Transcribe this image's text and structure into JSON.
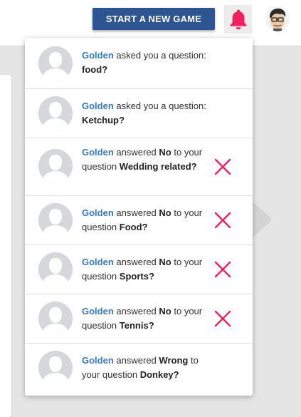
{
  "header": {
    "start_button": "START A NEW GAME",
    "bell_color": "#f1215f",
    "button_color": "#2c5591"
  },
  "notifications": [
    {
      "name": "Golden",
      "verb": "asked you a question:",
      "answer": "",
      "mid": "",
      "subject": "food?",
      "dismissible": false
    },
    {
      "name": "Golden",
      "verb": "asked you a question:",
      "answer": "",
      "mid": "",
      "subject": "Ketchup?",
      "dismissible": false
    },
    {
      "name": "Golden",
      "verb": "answered",
      "answer": "No",
      "mid": "to your question",
      "subject": "Wedding related?",
      "dismissible": true
    },
    {
      "name": "Golden",
      "verb": "answered",
      "answer": "No",
      "mid": "to your question",
      "subject": "Food?",
      "dismissible": true
    },
    {
      "name": "Golden",
      "verb": "answered",
      "answer": "No",
      "mid": "to your question",
      "subject": "Sports?",
      "dismissible": true
    },
    {
      "name": "Golden",
      "verb": "answered",
      "answer": "No",
      "mid": "to your question",
      "subject": "Tennis?",
      "dismissible": true
    },
    {
      "name": "Golden",
      "verb": "answered",
      "answer": "Wrong",
      "mid": "to your question",
      "subject": "Donkey?",
      "dismissible": false
    }
  ],
  "icons": {
    "bell": "bell-icon",
    "dismiss": "close-icon",
    "avatar": "user-avatar-icon"
  }
}
